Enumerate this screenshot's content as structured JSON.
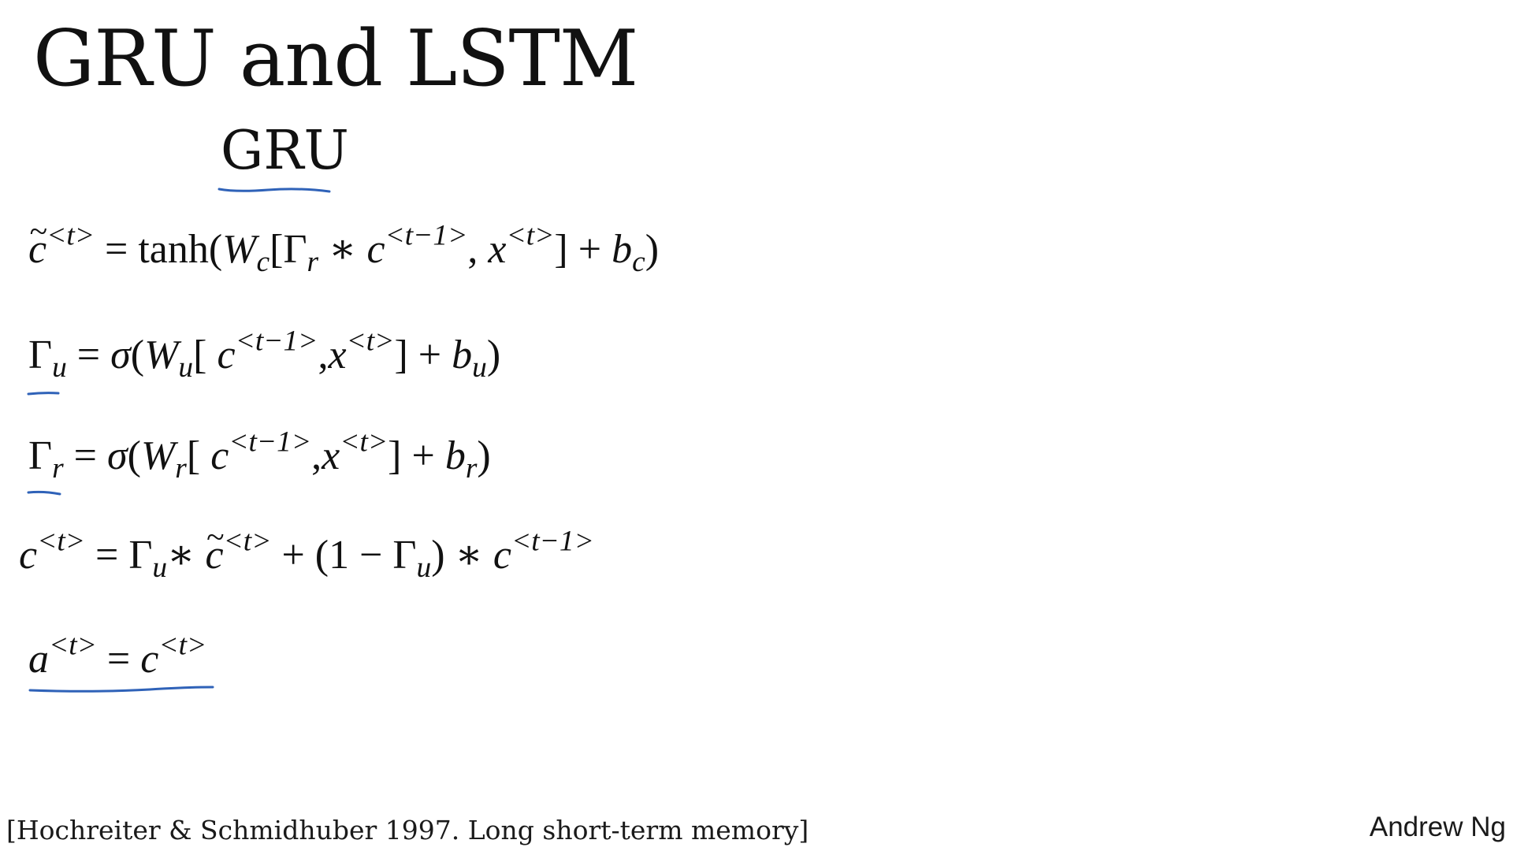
{
  "slide": {
    "title": "GRU and LSTM",
    "subtitle": "GRU",
    "equations": {
      "candidate": {
        "lhs": "c",
        "lhs_sup": "<t>",
        "eq": " = ",
        "func": "tanh(",
        "w": "W",
        "w_sub": "c",
        "b1": "[Γ",
        "gamma_sub": "r",
        "star": " ∗ ",
        "c_prev": "c",
        "c_prev_sup": "<t−1>",
        "comma": ", ",
        "x": "x",
        "x_sup": "<t>",
        "close": "] + ",
        "b": "b",
        "b_sub": "c",
        "end": ")"
      },
      "update_gate": {
        "lhs": "Γ",
        "lhs_sub": "u",
        "eq": " = ",
        "sigma": "σ",
        "open": "(",
        "w": "W",
        "w_sub": "u",
        "b1": "[ ",
        "c_prev": "c",
        "c_prev_sup": "<t−1>",
        "comma": ",",
        "x": "x",
        "x_sup": "<t>",
        "close": "] + ",
        "b": "b",
        "b_sub": "u",
        "end": ")"
      },
      "relevance_gate": {
        "lhs": "Γ",
        "lhs_sub": "r",
        "eq": " = ",
        "sigma": "σ",
        "open": "(",
        "w": "W",
        "w_sub": "r",
        "b1": "[ ",
        "c_prev": "c",
        "c_prev_sup": "<t−1>",
        "comma": ",",
        "x": "x",
        "x_sup": "<t>",
        "close": "] + ",
        "b": "b",
        "b_sub": "r",
        "end": ")"
      },
      "memory_update": {
        "lhs": "c",
        "lhs_sup": "<t>",
        "eq": " = Γ",
        "g1_sub": "u",
        "star1": "∗ ",
        "ct": "c",
        "ct_sup": "<t>",
        "mid": " + (1 − Γ",
        "g2_sub": "u",
        "star2": ") ∗ ",
        "c_prev": "c",
        "c_prev_sup": "<t−1>"
      },
      "activation": {
        "lhs": "a",
        "lhs_sup": "<t>",
        "eq": " = ",
        "rhs": "c",
        "rhs_sup": "<t>"
      }
    },
    "citation": "[Hochreiter & Schmidhuber 1997. Long short-term memory]",
    "author": "Andrew Ng",
    "colors": {
      "ink": "#111111",
      "pen_annotation": "#2f62b8",
      "background": "#ffffff"
    }
  }
}
